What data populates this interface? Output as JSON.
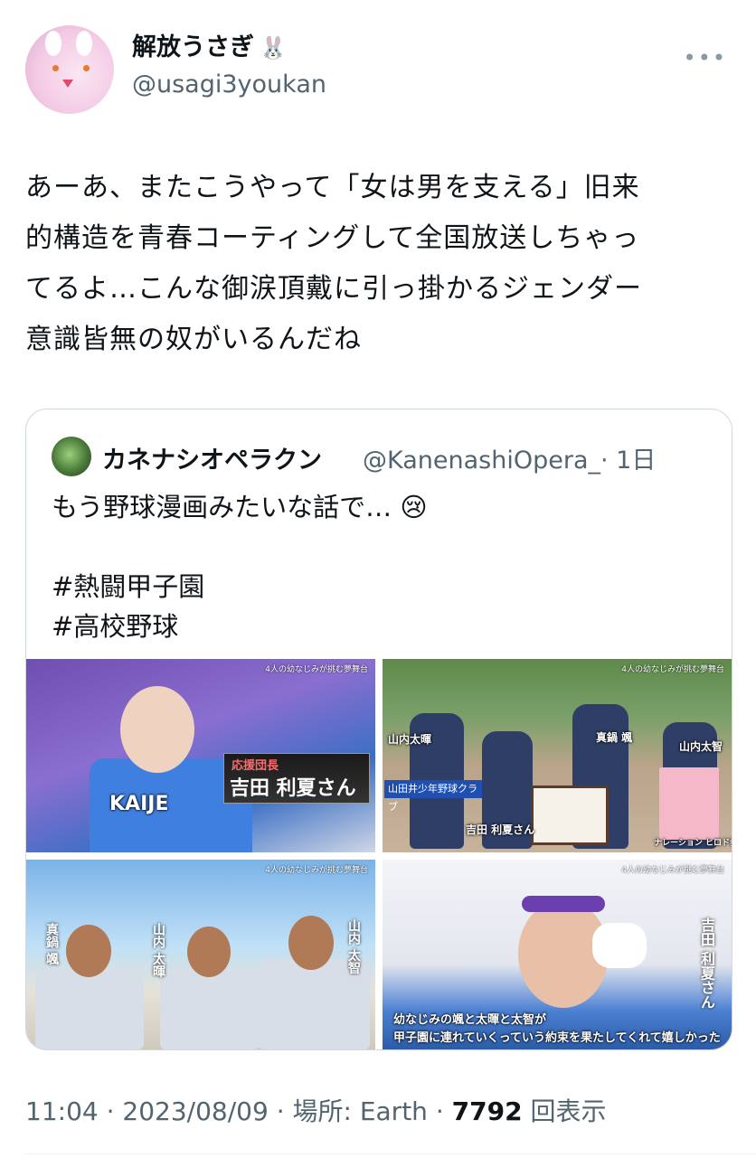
{
  "tweet": {
    "display_name": "解放うさぎ",
    "name_emoji": "🐰",
    "handle": "@usagi3youkan",
    "more_icon": "•••",
    "text_lines": [
      "あーあ、またこうやって「女は男を支える」旧来",
      "的構造を青春コーティングして全国放送しちゃっ",
      "てるよ…こんな御涙頂戴に引っ掛かるジェンダー",
      "意識皆無の奴がいるんだね"
    ],
    "time": "11:04 · 2023/08/09",
    "location_label": "場所: Earth",
    "views_count": "7792",
    "views_label": "回表示"
  },
  "quote": {
    "display_name": "カネナシオペラクン",
    "handle": "@KanenashiOpera_",
    "age": "· 1日",
    "text_line1": "もう野球漫画みたいな話で… 😢",
    "hashtag1": "#熱闘甲子園",
    "hashtag2": "#高校野球",
    "media": {
      "tag": "4人の幼なじみが挑む夢舞台",
      "img1_role": "応援団長",
      "img1_name": "吉田 利夏さん",
      "img1_shirt": "KAIJE",
      "img2_club": "山田井少年野球クラブ",
      "img2_label_left": "山内太暉",
      "img2_label_top": "真鍋 颯",
      "img2_label_right": "山内太智",
      "img2_label_bottom": "吉田 利夏さん",
      "img2_narration": "ナレーション ヒロド歩美",
      "img3_left": "真鍋 颯",
      "img3_mid": "山内 太暉",
      "img3_right": "山内 太智",
      "img4_side": "吉田 利夏さん",
      "img4_sub1": "幼なじみの颯と太暉と太智が",
      "img4_sub2": "甲子園に連れていくっていう約束を果たしてくれて嬉しかった"
    }
  }
}
